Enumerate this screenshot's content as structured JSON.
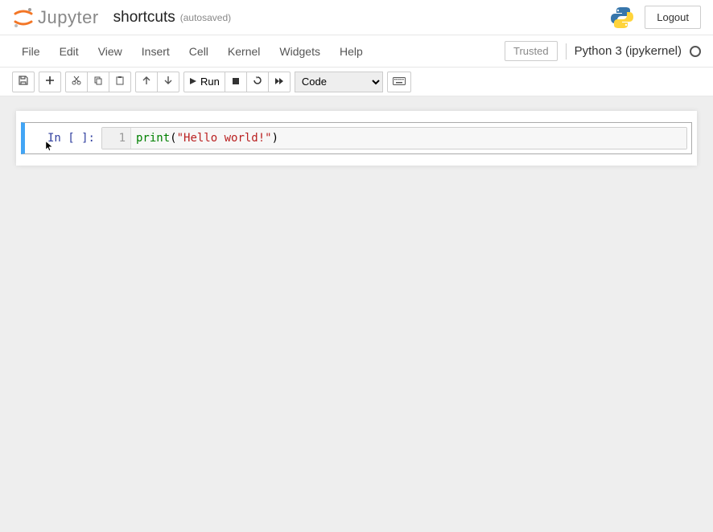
{
  "header": {
    "logo_text": "Jupyter",
    "notebook_name": "shortcuts",
    "autosaved": "(autosaved)",
    "logout": "Logout"
  },
  "menu": {
    "items": [
      "File",
      "Edit",
      "View",
      "Insert",
      "Cell",
      "Kernel",
      "Widgets",
      "Help"
    ],
    "trusted": "Trusted",
    "kernel_name": "Python 3 (ipykernel)"
  },
  "toolbar": {
    "run_label": "Run",
    "cell_type": "Code"
  },
  "cell": {
    "prompt": "In [ ]:",
    "line_number": "1",
    "code": {
      "fn": "print",
      "lparen": "(",
      "string": "\"Hello world!\"",
      "rparen": ")"
    }
  }
}
